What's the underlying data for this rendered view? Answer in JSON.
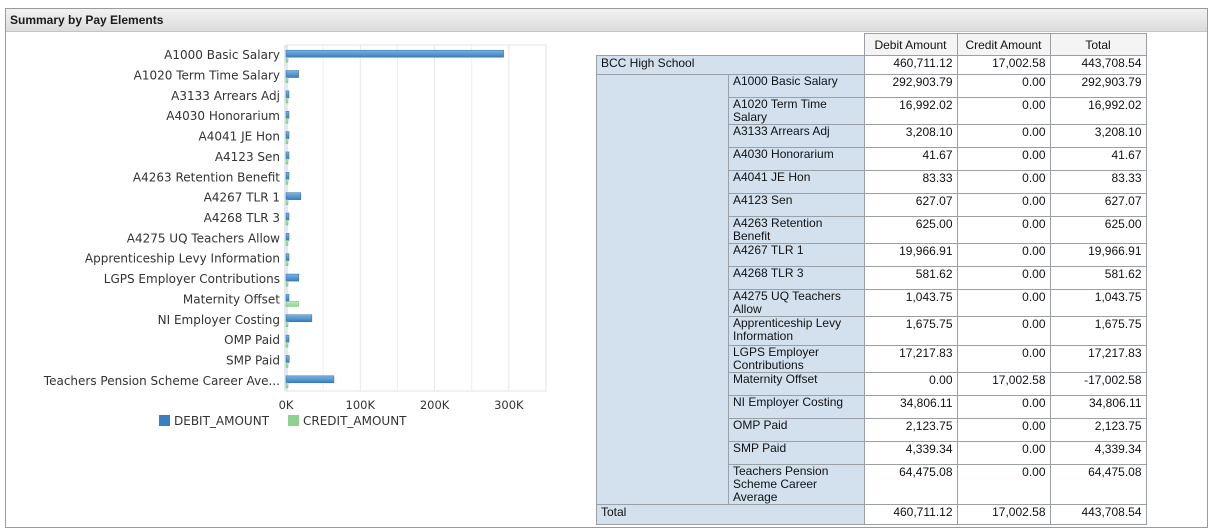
{
  "panel": {
    "title": "Summary by Pay Elements"
  },
  "chart_data": {
    "type": "bar",
    "orientation": "horizontal",
    "categories": [
      "A1000 Basic Salary",
      "A1020 Term Time Salary",
      "A3133 Arrears Adj",
      "A4030 Honorarium",
      "A4041 JE Hon",
      "A4123 Sen",
      "A4263 Retention Benefit",
      "A4267 TLR 1",
      "A4268 TLR 3",
      "A4275 UQ Teachers Allow",
      "Apprenticeship Levy Information",
      "LGPS Employer Contributions",
      "Maternity Offset",
      "NI Employer Costing",
      "OMP Paid",
      "SMP Paid",
      "Teachers Pension Scheme Career Ave..."
    ],
    "series": [
      {
        "name": "DEBIT_AMOUNT",
        "values": [
          292903.79,
          16992.02,
          3208.1,
          41.67,
          83.33,
          627.07,
          625.0,
          19966.91,
          581.62,
          1043.75,
          1675.75,
          17217.83,
          0.0,
          34806.11,
          2123.75,
          4339.34,
          64475.08
        ]
      },
      {
        "name": "CREDIT_AMOUNT",
        "values": [
          0,
          0,
          0,
          0,
          0,
          0,
          0,
          0,
          0,
          0,
          0,
          0,
          17002.58,
          0,
          0,
          0,
          0
        ]
      }
    ],
    "xlim": [
      0,
      350000
    ],
    "ticks": [
      0,
      100000,
      200000,
      300000
    ],
    "tick_labels": [
      "0K",
      "100K",
      "200K",
      "300K"
    ],
    "grid": true,
    "legend": "bottom",
    "colors": {
      "debit": "#3a7fbf",
      "credit": "#8fd18f"
    }
  },
  "table": {
    "headers": [
      "Debit Amount",
      "Credit Amount",
      "Total"
    ],
    "group": {
      "name": "BCC High School",
      "debit": "460,711.12",
      "credit": "17,002.58",
      "total": "443,708.54"
    },
    "rows": [
      {
        "name": "A1000 Basic Salary",
        "debit": "292,903.79",
        "credit": "0.00",
        "total": "292,903.79"
      },
      {
        "name": "A1020 Term Time Salary",
        "debit": "16,992.02",
        "credit": "0.00",
        "total": "16,992.02"
      },
      {
        "name": "A3133 Arrears Adj",
        "debit": "3,208.10",
        "credit": "0.00",
        "total": "3,208.10"
      },
      {
        "name": "A4030 Honorarium",
        "debit": "41.67",
        "credit": "0.00",
        "total": "41.67"
      },
      {
        "name": "A4041 JE Hon",
        "debit": "83.33",
        "credit": "0.00",
        "total": "83.33"
      },
      {
        "name": "A4123 Sen",
        "debit": "627.07",
        "credit": "0.00",
        "total": "627.07"
      },
      {
        "name": "A4263 Retention Benefit",
        "debit": "625.00",
        "credit": "0.00",
        "total": "625.00"
      },
      {
        "name": "A4267 TLR 1",
        "debit": "19,966.91",
        "credit": "0.00",
        "total": "19,966.91"
      },
      {
        "name": "A4268 TLR 3",
        "debit": "581.62",
        "credit": "0.00",
        "total": "581.62"
      },
      {
        "name": "A4275 UQ Teachers Allow",
        "debit": "1,043.75",
        "credit": "0.00",
        "total": "1,043.75"
      },
      {
        "name": "Apprenticeship Levy Information",
        "debit": "1,675.75",
        "credit": "0.00",
        "total": "1,675.75"
      },
      {
        "name": "LGPS Employer Contributions",
        "debit": "17,217.83",
        "credit": "0.00",
        "total": "17,217.83"
      },
      {
        "name": "Maternity Offset",
        "debit": "0.00",
        "credit": "17,002.58",
        "total": "-17,002.58"
      },
      {
        "name": "NI Employer Costing",
        "debit": "34,806.11",
        "credit": "0.00",
        "total": "34,806.11"
      },
      {
        "name": "OMP Paid",
        "debit": "2,123.75",
        "credit": "0.00",
        "total": "2,123.75"
      },
      {
        "name": "SMP Paid",
        "debit": "4,339.34",
        "credit": "0.00",
        "total": "4,339.34"
      },
      {
        "name": "Teachers Pension Scheme Career Average",
        "debit": "64,475.08",
        "credit": "0.00",
        "total": "64,475.08"
      }
    ],
    "total": {
      "label": "Total",
      "debit": "460,711.12",
      "credit": "17,002.58",
      "total": "443,708.54"
    }
  }
}
